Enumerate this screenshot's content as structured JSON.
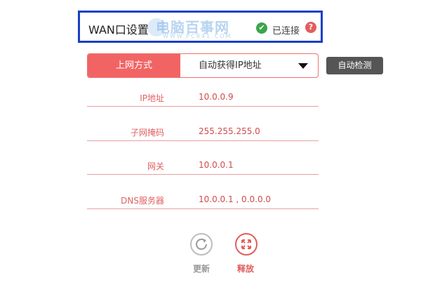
{
  "header": {
    "title": "WAN口设置",
    "status": "已连接",
    "status_icon": "check-circle-icon",
    "help_icon": "question-mark-icon",
    "help_glyph": "?",
    "watermark": "电脑百事网",
    "watermark_sub": "WWW.PC841.COM"
  },
  "connection": {
    "label": "上网方式",
    "value": "自动获得IP地址",
    "auto_detect_label": "自动检测"
  },
  "info_rows": [
    {
      "label": "IP地址",
      "value": "10.0.0.9"
    },
    {
      "label": "子网掩码",
      "value": "255.255.255.0"
    },
    {
      "label": "网关",
      "value": "10.0.0.1"
    },
    {
      "label": "DNS服务器",
      "value": "10.0.0.1 , 0.0.0.0"
    }
  ],
  "actions": {
    "refresh_label": "更新",
    "release_label": "释放"
  },
  "colors": {
    "accent": "#f26464",
    "frame": "#1a3fc4",
    "ok": "#3aa54a"
  }
}
